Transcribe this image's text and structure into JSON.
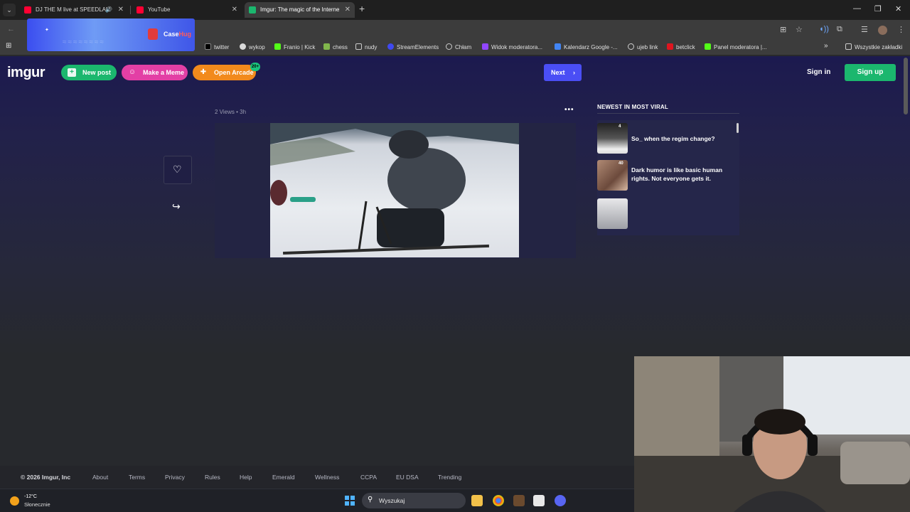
{
  "browser": {
    "tabs": [
      {
        "title": "DJ THE M live at SPEEDLAN",
        "favicon_color": "#ff0033"
      },
      {
        "title": "YouTube",
        "favicon_color": "#ff0033"
      },
      {
        "title": "Imgur: The magic of the Interne",
        "favicon_color": "#1bb76e"
      }
    ],
    "bookmarks": [
      {
        "label": "twitter",
        "icon": "x-icon"
      },
      {
        "label": "wykop",
        "icon": "wykop-icon"
      },
      {
        "label": "Franio | Kick",
        "icon": "kick-icon"
      },
      {
        "label": "chess",
        "icon": "pawn-icon"
      },
      {
        "label": "nudy",
        "icon": "folder-icon"
      },
      {
        "label": "StreamElements",
        "icon": "streamelements-icon"
      },
      {
        "label": "Chłam",
        "icon": "globe-icon"
      },
      {
        "label": "Widok moderatora...",
        "icon": "twitch-icon"
      },
      {
        "label": "Kalendarz Google -...",
        "icon": "calendar-icon"
      },
      {
        "label": "ujeb link",
        "icon": "globe-icon"
      },
      {
        "label": "betclick",
        "icon": "betclick-icon"
      },
      {
        "label": "Panel moderatora |...",
        "icon": "kick-icon"
      }
    ],
    "all_bookmarks": "Wszystkie zakładki",
    "ad_brand": "Case",
    "ad_brand_accent": "Hug"
  },
  "imgur": {
    "logo": "imgur",
    "new_post": "New post",
    "make_meme": "Make a Meme",
    "open_arcade": "Open Arcade",
    "arcade_badge": "20+",
    "next": "Next",
    "sign_in": "Sign in",
    "sign_up": "Sign up",
    "post_meta": "2 Views • 3h",
    "sidebar_title": "NEWEST IN MOST VIRAL",
    "sidebar_items": [
      {
        "title": "So_ when the regim change?",
        "count": "4"
      },
      {
        "title": "Dark humor is like basic human rights.  Not everyone gets it.",
        "count": "40"
      },
      {
        "title": "",
        "count": ""
      }
    ],
    "footer": {
      "copyright": "© 2026 Imgur, Inc",
      "links": [
        "About",
        "Terms",
        "Privacy",
        "Rules",
        "Help",
        "Emerald",
        "Wellness",
        "CCPA",
        "EU DSA",
        "Trending"
      ]
    }
  },
  "taskbar": {
    "temperature": "-12°C",
    "condition": "Słonecznie",
    "search_placeholder": "Wyszukaj"
  }
}
